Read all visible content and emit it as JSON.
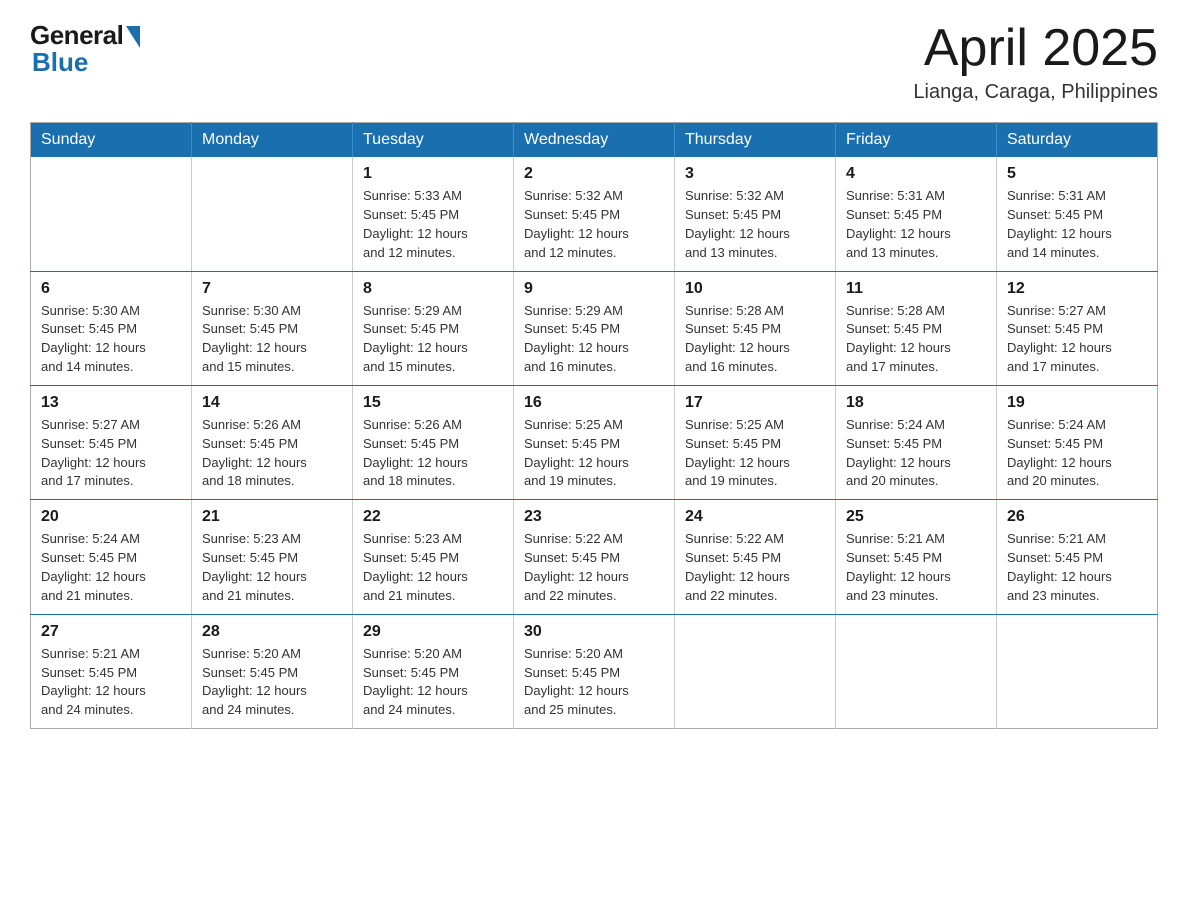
{
  "header": {
    "logo": {
      "general": "General",
      "blue": "Blue"
    },
    "title": "April 2025",
    "location": "Lianga, Caraga, Philippines"
  },
  "calendar": {
    "days_of_week": [
      "Sunday",
      "Monday",
      "Tuesday",
      "Wednesday",
      "Thursday",
      "Friday",
      "Saturday"
    ],
    "weeks": [
      [
        {
          "day": "",
          "info": ""
        },
        {
          "day": "",
          "info": ""
        },
        {
          "day": "1",
          "info": "Sunrise: 5:33 AM\nSunset: 5:45 PM\nDaylight: 12 hours\nand 12 minutes."
        },
        {
          "day": "2",
          "info": "Sunrise: 5:32 AM\nSunset: 5:45 PM\nDaylight: 12 hours\nand 12 minutes."
        },
        {
          "day": "3",
          "info": "Sunrise: 5:32 AM\nSunset: 5:45 PM\nDaylight: 12 hours\nand 13 minutes."
        },
        {
          "day": "4",
          "info": "Sunrise: 5:31 AM\nSunset: 5:45 PM\nDaylight: 12 hours\nand 13 minutes."
        },
        {
          "day": "5",
          "info": "Sunrise: 5:31 AM\nSunset: 5:45 PM\nDaylight: 12 hours\nand 14 minutes."
        }
      ],
      [
        {
          "day": "6",
          "info": "Sunrise: 5:30 AM\nSunset: 5:45 PM\nDaylight: 12 hours\nand 14 minutes."
        },
        {
          "day": "7",
          "info": "Sunrise: 5:30 AM\nSunset: 5:45 PM\nDaylight: 12 hours\nand 15 minutes."
        },
        {
          "day": "8",
          "info": "Sunrise: 5:29 AM\nSunset: 5:45 PM\nDaylight: 12 hours\nand 15 minutes."
        },
        {
          "day": "9",
          "info": "Sunrise: 5:29 AM\nSunset: 5:45 PM\nDaylight: 12 hours\nand 16 minutes."
        },
        {
          "day": "10",
          "info": "Sunrise: 5:28 AM\nSunset: 5:45 PM\nDaylight: 12 hours\nand 16 minutes."
        },
        {
          "day": "11",
          "info": "Sunrise: 5:28 AM\nSunset: 5:45 PM\nDaylight: 12 hours\nand 17 minutes."
        },
        {
          "day": "12",
          "info": "Sunrise: 5:27 AM\nSunset: 5:45 PM\nDaylight: 12 hours\nand 17 minutes."
        }
      ],
      [
        {
          "day": "13",
          "info": "Sunrise: 5:27 AM\nSunset: 5:45 PM\nDaylight: 12 hours\nand 17 minutes."
        },
        {
          "day": "14",
          "info": "Sunrise: 5:26 AM\nSunset: 5:45 PM\nDaylight: 12 hours\nand 18 minutes."
        },
        {
          "day": "15",
          "info": "Sunrise: 5:26 AM\nSunset: 5:45 PM\nDaylight: 12 hours\nand 18 minutes."
        },
        {
          "day": "16",
          "info": "Sunrise: 5:25 AM\nSunset: 5:45 PM\nDaylight: 12 hours\nand 19 minutes."
        },
        {
          "day": "17",
          "info": "Sunrise: 5:25 AM\nSunset: 5:45 PM\nDaylight: 12 hours\nand 19 minutes."
        },
        {
          "day": "18",
          "info": "Sunrise: 5:24 AM\nSunset: 5:45 PM\nDaylight: 12 hours\nand 20 minutes."
        },
        {
          "day": "19",
          "info": "Sunrise: 5:24 AM\nSunset: 5:45 PM\nDaylight: 12 hours\nand 20 minutes."
        }
      ],
      [
        {
          "day": "20",
          "info": "Sunrise: 5:24 AM\nSunset: 5:45 PM\nDaylight: 12 hours\nand 21 minutes."
        },
        {
          "day": "21",
          "info": "Sunrise: 5:23 AM\nSunset: 5:45 PM\nDaylight: 12 hours\nand 21 minutes."
        },
        {
          "day": "22",
          "info": "Sunrise: 5:23 AM\nSunset: 5:45 PM\nDaylight: 12 hours\nand 21 minutes."
        },
        {
          "day": "23",
          "info": "Sunrise: 5:22 AM\nSunset: 5:45 PM\nDaylight: 12 hours\nand 22 minutes."
        },
        {
          "day": "24",
          "info": "Sunrise: 5:22 AM\nSunset: 5:45 PM\nDaylight: 12 hours\nand 22 minutes."
        },
        {
          "day": "25",
          "info": "Sunrise: 5:21 AM\nSunset: 5:45 PM\nDaylight: 12 hours\nand 23 minutes."
        },
        {
          "day": "26",
          "info": "Sunrise: 5:21 AM\nSunset: 5:45 PM\nDaylight: 12 hours\nand 23 minutes."
        }
      ],
      [
        {
          "day": "27",
          "info": "Sunrise: 5:21 AM\nSunset: 5:45 PM\nDaylight: 12 hours\nand 24 minutes."
        },
        {
          "day": "28",
          "info": "Sunrise: 5:20 AM\nSunset: 5:45 PM\nDaylight: 12 hours\nand 24 minutes."
        },
        {
          "day": "29",
          "info": "Sunrise: 5:20 AM\nSunset: 5:45 PM\nDaylight: 12 hours\nand 24 minutes."
        },
        {
          "day": "30",
          "info": "Sunrise: 5:20 AM\nSunset: 5:45 PM\nDaylight: 12 hours\nand 25 minutes."
        },
        {
          "day": "",
          "info": ""
        },
        {
          "day": "",
          "info": ""
        },
        {
          "day": "",
          "info": ""
        }
      ]
    ]
  }
}
